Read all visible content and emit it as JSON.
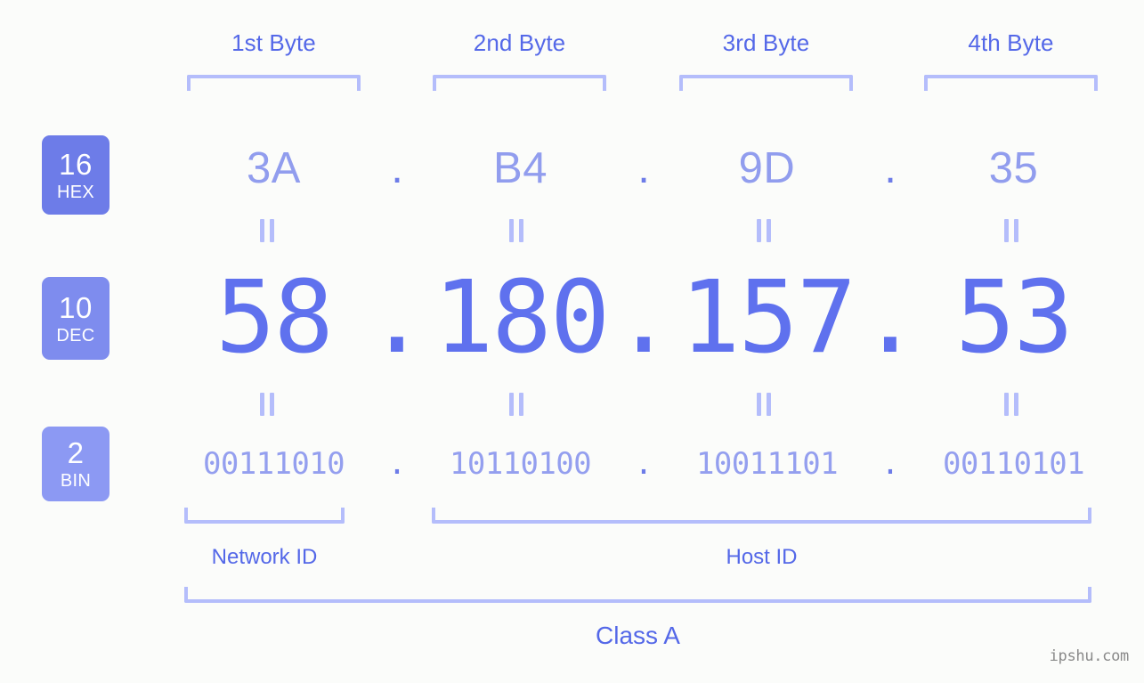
{
  "ip": {
    "address_decimal": "58.180.157.53",
    "separator": "."
  },
  "headers": {
    "bytes": [
      {
        "label": "1st Byte"
      },
      {
        "label": "2nd Byte"
      },
      {
        "label": "3rd Byte"
      },
      {
        "label": "4th Byte"
      }
    ]
  },
  "bases": [
    {
      "id": "hex",
      "number": "16",
      "name": "HEX",
      "color": "#6d7ce8"
    },
    {
      "id": "dec",
      "number": "10",
      "name": "DEC",
      "color": "#7e8cee"
    },
    {
      "id": "bin",
      "number": "2",
      "name": "BIN",
      "color": "#8c99f3"
    }
  ],
  "rows": {
    "hex": {
      "values": [
        "3A",
        "B4",
        "9D",
        "35"
      ]
    },
    "dec": {
      "values": [
        "58",
        "180",
        "157",
        "53"
      ]
    },
    "bin": {
      "values": [
        "00111010",
        "10110100",
        "10011101",
        "00110101"
      ]
    }
  },
  "equality_symbol": "||",
  "sections": {
    "network_id": {
      "label": "Network ID"
    },
    "host_id": {
      "label": "Host ID"
    },
    "class": {
      "label": "Class A"
    }
  },
  "watermark": {
    "text": "ipshu.com"
  },
  "palette": {
    "background": "#fbfcfa",
    "bracket": "#b4bdfb",
    "header_text": "#5468e8",
    "hex_text": "#919dee",
    "dec_text": "#5f71ee",
    "bin_text": "#949fef",
    "watermark_text": "#8a8a8a"
  }
}
